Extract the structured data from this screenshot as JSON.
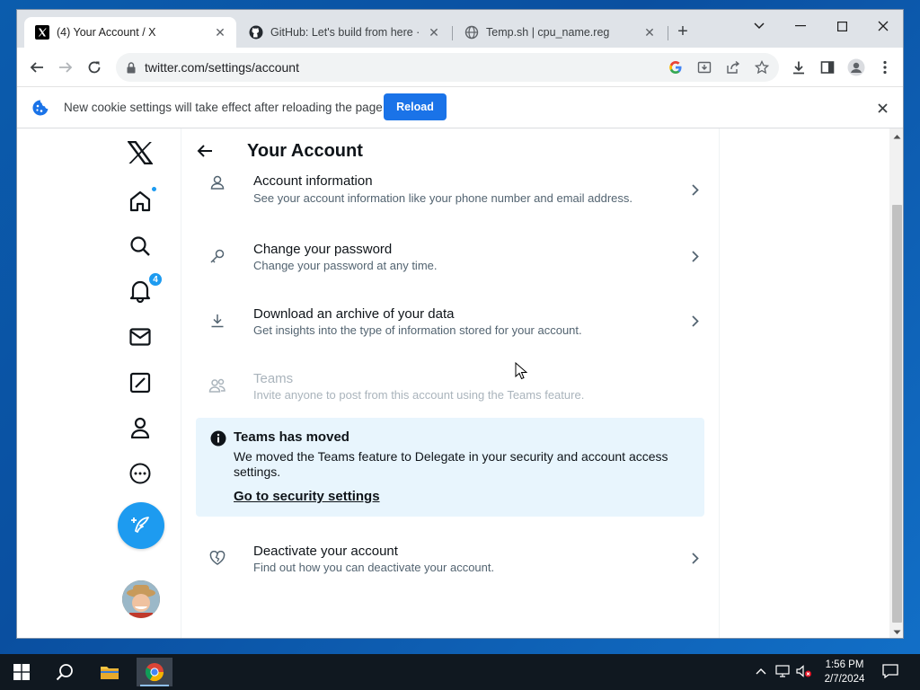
{
  "browser": {
    "tabs": [
      {
        "title": "(4) Your Account / X",
        "active": true
      },
      {
        "title": "GitHub: Let's build from here · GitHub",
        "active": false
      },
      {
        "title": "Temp.sh | cpu_name.reg",
        "active": false
      }
    ],
    "url": "twitter.com/settings/account",
    "infobar": {
      "message": "New cookie settings will take effect after reloading the page",
      "button_label": "Reload"
    }
  },
  "sidebar": {
    "notification_count": "4",
    "items": [
      "x-logo",
      "home-icon",
      "search-icon",
      "bell-icon",
      "mail-icon",
      "grok-icon",
      "profile-icon",
      "more-icon"
    ]
  },
  "settings": {
    "title": "Your Account",
    "rows": [
      {
        "title": "Account information",
        "desc": "See your account information like your phone number and email address."
      },
      {
        "title": "Change your password",
        "desc": "Change your password at any time."
      },
      {
        "title": "Download an archive of your data",
        "desc": "Get insights into the type of information stored for your account."
      },
      {
        "title": "Teams",
        "desc": "Invite anyone to post from this account using the Teams feature."
      },
      {
        "title": "Deactivate your account",
        "desc": "Find out how you can deactivate your account."
      }
    ],
    "notice": {
      "title": "Teams has moved",
      "body": "We moved the Teams feature to Delegate in your security and account access settings.",
      "link": "Go to security settings"
    }
  },
  "taskbar": {
    "time": "1:56 PM",
    "date": "2/7/2024"
  },
  "colors": {
    "accent": "#1d9bf0",
    "reload_button": "#1a73e8",
    "notice_bg": "#e8f5fd"
  }
}
